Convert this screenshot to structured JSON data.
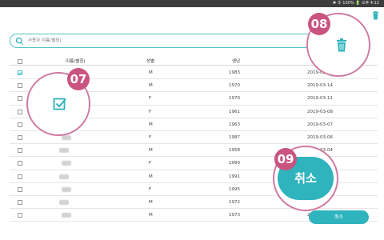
{
  "status_bar": {
    "text": "✱ 令 100% 🔋 오후 4:12"
  },
  "search": {
    "placeholder": "사용자 이름(별칭)"
  },
  "table": {
    "headers": [
      "이름(별칭)",
      "성별",
      "생년",
      "2"
    ],
    "rows": [
      {
        "checked": true,
        "name": "",
        "gender": "M",
        "birth_year": "1983",
        "date": "2019-03-14"
      },
      {
        "checked": false,
        "name": "",
        "gender": "M",
        "birth_year": "1970",
        "date": "2019-03-14"
      },
      {
        "checked": false,
        "name": "",
        "gender": "F",
        "birth_year": "1970",
        "date": "2019-03-11"
      },
      {
        "checked": false,
        "name": "",
        "gender": "F",
        "birth_year": "1961",
        "date": "2019-03-08"
      },
      {
        "checked": false,
        "name": "",
        "gender": "M",
        "birth_year": "1963",
        "date": "2019-03-07"
      },
      {
        "checked": false,
        "name": "",
        "gender": "F",
        "birth_year": "1987",
        "date": "2019-03-06"
      },
      {
        "checked": false,
        "name": "",
        "gender": "M",
        "birth_year": "1958",
        "date": "2019-03-04"
      },
      {
        "checked": false,
        "name": "",
        "gender": "F",
        "birth_year": "1990",
        "date": ""
      },
      {
        "checked": false,
        "name": "",
        "gender": "M",
        "birth_year": "1991",
        "date": ""
      },
      {
        "checked": false,
        "name": "",
        "gender": "F",
        "birth_year": "1995",
        "date": ""
      },
      {
        "checked": false,
        "name": "",
        "gender": "M",
        "birth_year": "1972",
        "date": ""
      },
      {
        "checked": false,
        "name": "",
        "gender": "M",
        "birth_year": "1973",
        "date": "2019-03-01"
      }
    ]
  },
  "callouts": {
    "checkbox_badge": "07",
    "delete_badge": "08",
    "cancel_badge": "09"
  },
  "buttons": {
    "cancel_large": "취소",
    "cancel_small": "취소"
  },
  "colors": {
    "accent": "#2fb3bd",
    "badge": "#c9547f",
    "callout_border": "#cf7aa1"
  },
  "icons": [
    "search-icon",
    "trash-icon",
    "checkbox-checked-icon"
  ]
}
